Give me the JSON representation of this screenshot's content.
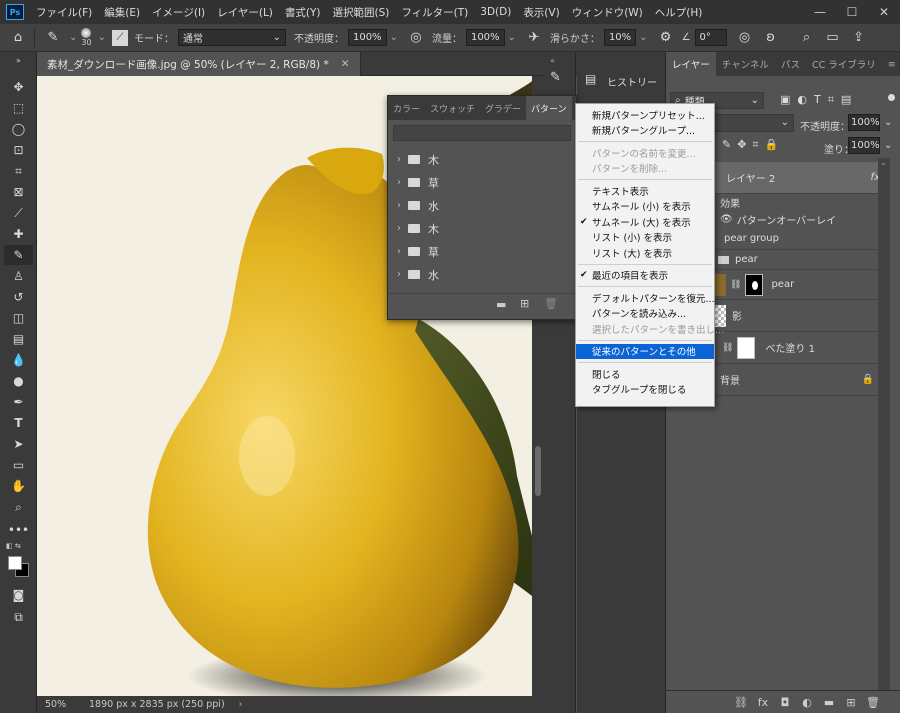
{
  "menubar": {
    "logo": "Ps",
    "items": [
      "ファイル(F)",
      "編集(E)",
      "イメージ(I)",
      "レイヤー(L)",
      "書式(Y)",
      "選択範囲(S)",
      "フィルター(T)",
      "3D(D)",
      "表示(V)",
      "ウィンドウ(W)",
      "ヘルプ(H)"
    ],
    "window_buttons": [
      "—",
      "☐",
      "✕"
    ]
  },
  "options": {
    "brush_size": "30",
    "mode_label": "モード：",
    "mode_value": "通常",
    "opacity_label": "不透明度：",
    "opacity_value": "100%",
    "flow_label": "流量：",
    "flow_value": "100%",
    "smoothing_label": "滑らかさ：",
    "smoothing_value": "10%",
    "angle_value": "0°"
  },
  "document": {
    "tab_title": "素材_ダウンロード画像.jpg @ 50% (レイヤー 2, RGB/8) *",
    "zoom": "50%",
    "dimensions": "1890 px x 2835 px (250 ppi)"
  },
  "history": {
    "label": "ヒストリー"
  },
  "patterns_panel": {
    "tabs": [
      "カラー",
      "スウォッチ",
      "グラデー",
      "パターン"
    ],
    "collapse": "»",
    "groups": [
      "木",
      "草",
      "水",
      "木",
      "草",
      "水"
    ]
  },
  "context_menu": {
    "items": [
      {
        "label": "新規パターンプリセット...",
        "state": "normal"
      },
      {
        "label": "新規パターングループ...",
        "state": "normal"
      },
      {
        "sep": true
      },
      {
        "label": "パターンの名前を変更...",
        "state": "disabled"
      },
      {
        "label": "パターンを削除...",
        "state": "disabled"
      },
      {
        "sep": true
      },
      {
        "label": "テキスト表示",
        "state": "normal"
      },
      {
        "label": "サムネール (小) を表示",
        "state": "normal"
      },
      {
        "label": "サムネール (大) を表示",
        "state": "checked"
      },
      {
        "label": "リスト (小) を表示",
        "state": "normal"
      },
      {
        "label": "リスト (大) を表示",
        "state": "normal"
      },
      {
        "sep": true
      },
      {
        "label": "最近の項目を表示",
        "state": "checked"
      },
      {
        "sep": true
      },
      {
        "label": "デフォルトパターンを復元...",
        "state": "normal"
      },
      {
        "label": "パターンを読み込み...",
        "state": "normal"
      },
      {
        "label": "選択したパターンを書き出し...",
        "state": "disabled"
      },
      {
        "sep": true
      },
      {
        "label": "従来のパターンとその他",
        "state": "highlighted"
      },
      {
        "sep": true
      },
      {
        "label": "閉じる",
        "state": "normal"
      },
      {
        "label": "タブグループを閉じる",
        "state": "normal"
      }
    ]
  },
  "layers_panel": {
    "tabs": [
      "レイヤー",
      "チャンネル",
      "パス",
      "CC ライブラリ"
    ],
    "filter_label": "種類",
    "opacity_label": "不透明度：",
    "opacity_value": "100%",
    "fill_label": "塗り：",
    "fill_value": "100%",
    "layers": {
      "layer2": "レイヤー 2",
      "fx": "fx",
      "effects": "効果",
      "pattern_overlay": "パターンオーバーレイ",
      "pear_group": "pear group",
      "pear_folder": "pear",
      "pear_layer": "pear",
      "shadow": "影",
      "solid_fill": "べた塗り 1",
      "background": "背景"
    }
  },
  "colors": {
    "accent": "#31a8ff",
    "menu_highlight": "#0a64d6",
    "pear_yellow": "#e3b420",
    "leaf_green": "#3f4a1c"
  }
}
